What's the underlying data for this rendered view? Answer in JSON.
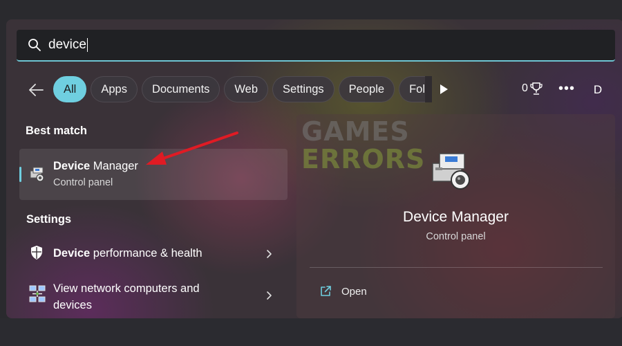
{
  "search": {
    "query": "device"
  },
  "filters": {
    "chips": [
      {
        "label": "All",
        "active": true
      },
      {
        "label": "Apps"
      },
      {
        "label": "Documents"
      },
      {
        "label": "Web"
      },
      {
        "label": "Settings"
      },
      {
        "label": "People"
      },
      {
        "label": "Folde"
      }
    ],
    "rewards_count": "0",
    "more_label": "•••",
    "avatar_initial": "D"
  },
  "results": {
    "best_match_title": "Best match",
    "best_match": {
      "title_bold": "Device",
      "title_rest": " Manager",
      "subtitle": "Control panel"
    },
    "settings_title": "Settings",
    "settings_items": [
      {
        "title_bold": "Device",
        "title_rest": " performance & health"
      },
      {
        "title_rest": "View network computers and",
        "title_line2": "devices"
      }
    ]
  },
  "details": {
    "title": "Device Manager",
    "subtitle": "Control panel",
    "open_label": "Open"
  },
  "watermark": {
    "line1": "GAMES",
    "line2": "ERRORS"
  },
  "colors": {
    "accent": "#6fcfe0",
    "arrow": "#e01b24"
  }
}
